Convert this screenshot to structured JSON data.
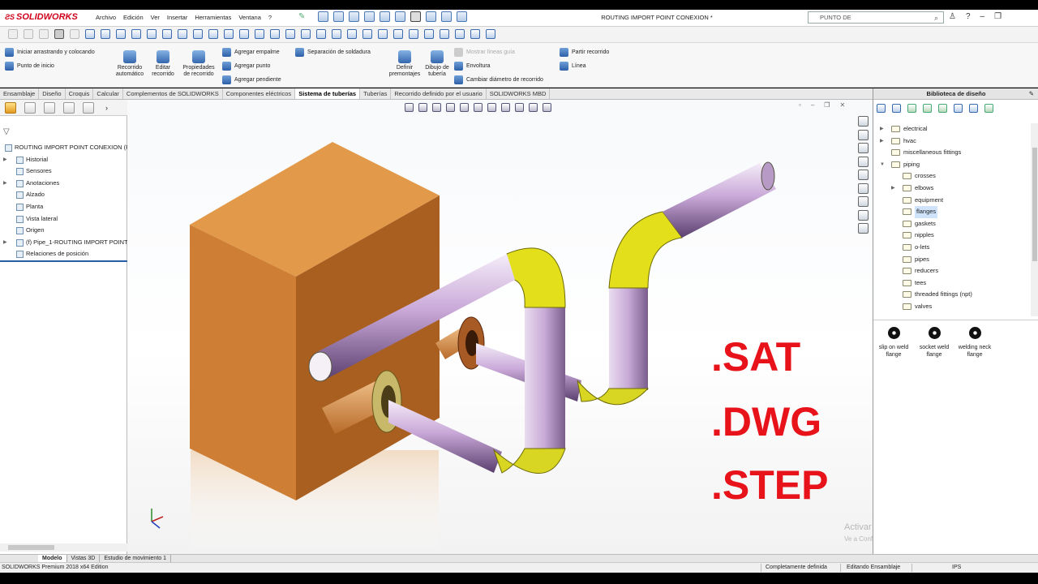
{
  "app": {
    "brand": "SOLIDWORKS",
    "document_title": "ROUTING IMPORT POINT CONEXION *",
    "menus": [
      "Archivo",
      "Edición",
      "Ver",
      "Insertar",
      "Herramientas",
      "Ventana",
      "?"
    ],
    "search_placeholder": "PUNTO DE"
  },
  "command_manager": {
    "col1": [
      "Iniciar arrastrando y colocando",
      "Punto de inicio"
    ],
    "recorrido_automatico": "Recorrido automático",
    "editar_recorrido": "Editar recorrido",
    "propiedades_recorrido": "Propiedades de recorrido",
    "col3": [
      "Agregar empalme",
      "Agregar punto",
      "Agregar pendiente"
    ],
    "separacion_soldadura": "Separación de soldadura",
    "definir_premontajes": "Definir premontajes",
    "dibujo_tuberia": "Dibujo de tubería",
    "col5": [
      "Mostrar líneas guía",
      "Envoltura",
      "Cambiar diámetro de recorrido"
    ],
    "col6": [
      "Partir recorrido",
      "Línea"
    ]
  },
  "tabs": [
    "Ensamblaje",
    "Diseño",
    "Croquis",
    "Calcular",
    "Complementos de SOLIDWORKS",
    "Componentes eléctricos",
    "Sistema de tuberías",
    "Tuberías",
    "Recorrido definido por el usuario",
    "SOLIDWORKS MBD"
  ],
  "active_tab": "Sistema de tuberías",
  "feature_tree": [
    {
      "label": "ROUTING IMPORT POINT CONEXION  (P",
      "level": 0,
      "expandable": false
    },
    {
      "label": "Historial",
      "level": 1,
      "expandable": true
    },
    {
      "label": "Sensores",
      "level": 1,
      "expandable": false
    },
    {
      "label": "Anotaciones",
      "level": 1,
      "expandable": true
    },
    {
      "label": "Alzado",
      "level": 1,
      "expandable": false
    },
    {
      "label": "Planta",
      "level": 1,
      "expandable": false
    },
    {
      "label": "Vista lateral",
      "level": 1,
      "expandable": false
    },
    {
      "label": "Origen",
      "level": 1,
      "expandable": false
    },
    {
      "label": "(f) Pipe_1-ROUTING IMPORT POINT",
      "level": 1,
      "expandable": true
    },
    {
      "label": "Relaciones de posición",
      "level": 1,
      "expandable": false
    }
  ],
  "overlay_formats": [
    ".SAT",
    ".DWG",
    ".STEP"
  ],
  "watermark": {
    "line1": "Activar Windows",
    "line2": "Ve a Configuración para activar Windows."
  },
  "design_library": {
    "title": "Biblioteca de diseño",
    "folders": [
      {
        "label": "electrical",
        "level": 0,
        "expandable": true,
        "selected": false
      },
      {
        "label": "hvac",
        "level": 0,
        "expandable": true,
        "selected": false
      },
      {
        "label": "miscellaneous fittings",
        "level": 0,
        "expandable": false,
        "selected": false
      },
      {
        "label": "piping",
        "level": 0,
        "expandable": true,
        "expanded": true,
        "selected": false
      },
      {
        "label": "crosses",
        "level": 1,
        "expandable": false,
        "selected": false
      },
      {
        "label": "elbows",
        "level": 1,
        "expandable": true,
        "selected": false
      },
      {
        "label": "equipment",
        "level": 1,
        "expandable": false,
        "selected": false
      },
      {
        "label": "flanges",
        "level": 1,
        "expandable": false,
        "selected": true
      },
      {
        "label": "gaskets",
        "level": 1,
        "expandable": false,
        "selected": false
      },
      {
        "label": "nipples",
        "level": 1,
        "expandable": false,
        "selected": false
      },
      {
        "label": "o-lets",
        "level": 1,
        "expandable": false,
        "selected": false
      },
      {
        "label": "pipes",
        "level": 1,
        "expandable": false,
        "selected": false
      },
      {
        "label": "reducers",
        "level": 1,
        "expandable": false,
        "selected": false
      },
      {
        "label": "tees",
        "level": 1,
        "expandable": false,
        "selected": false
      },
      {
        "label": "threaded fittings (npt)",
        "level": 1,
        "expandable": false,
        "selected": false
      },
      {
        "label": "valves",
        "level": 1,
        "expandable": false,
        "selected": false
      }
    ],
    "items": [
      "slip on weld flange",
      "socket weld flange",
      "welding neck flange"
    ]
  },
  "bottom_tabs": [
    "Modelo",
    "Vistas 3D",
    "Estudio de movimiento 1"
  ],
  "active_bottom_tab": "Modelo",
  "status": {
    "product": "SOLIDWORKS Premium 2018 x64 Edition",
    "definition": "Completamente definida",
    "mode": "Editando Ensamblaje",
    "units": "IPS"
  },
  "colors": {
    "brand_red": "#d0021b",
    "overlay_text": "#e8121a",
    "box": "#d47a2a",
    "pipe": "#c9a8d8",
    "elbow": "#e3e01b",
    "accent_blue": "#2a5ca8"
  }
}
